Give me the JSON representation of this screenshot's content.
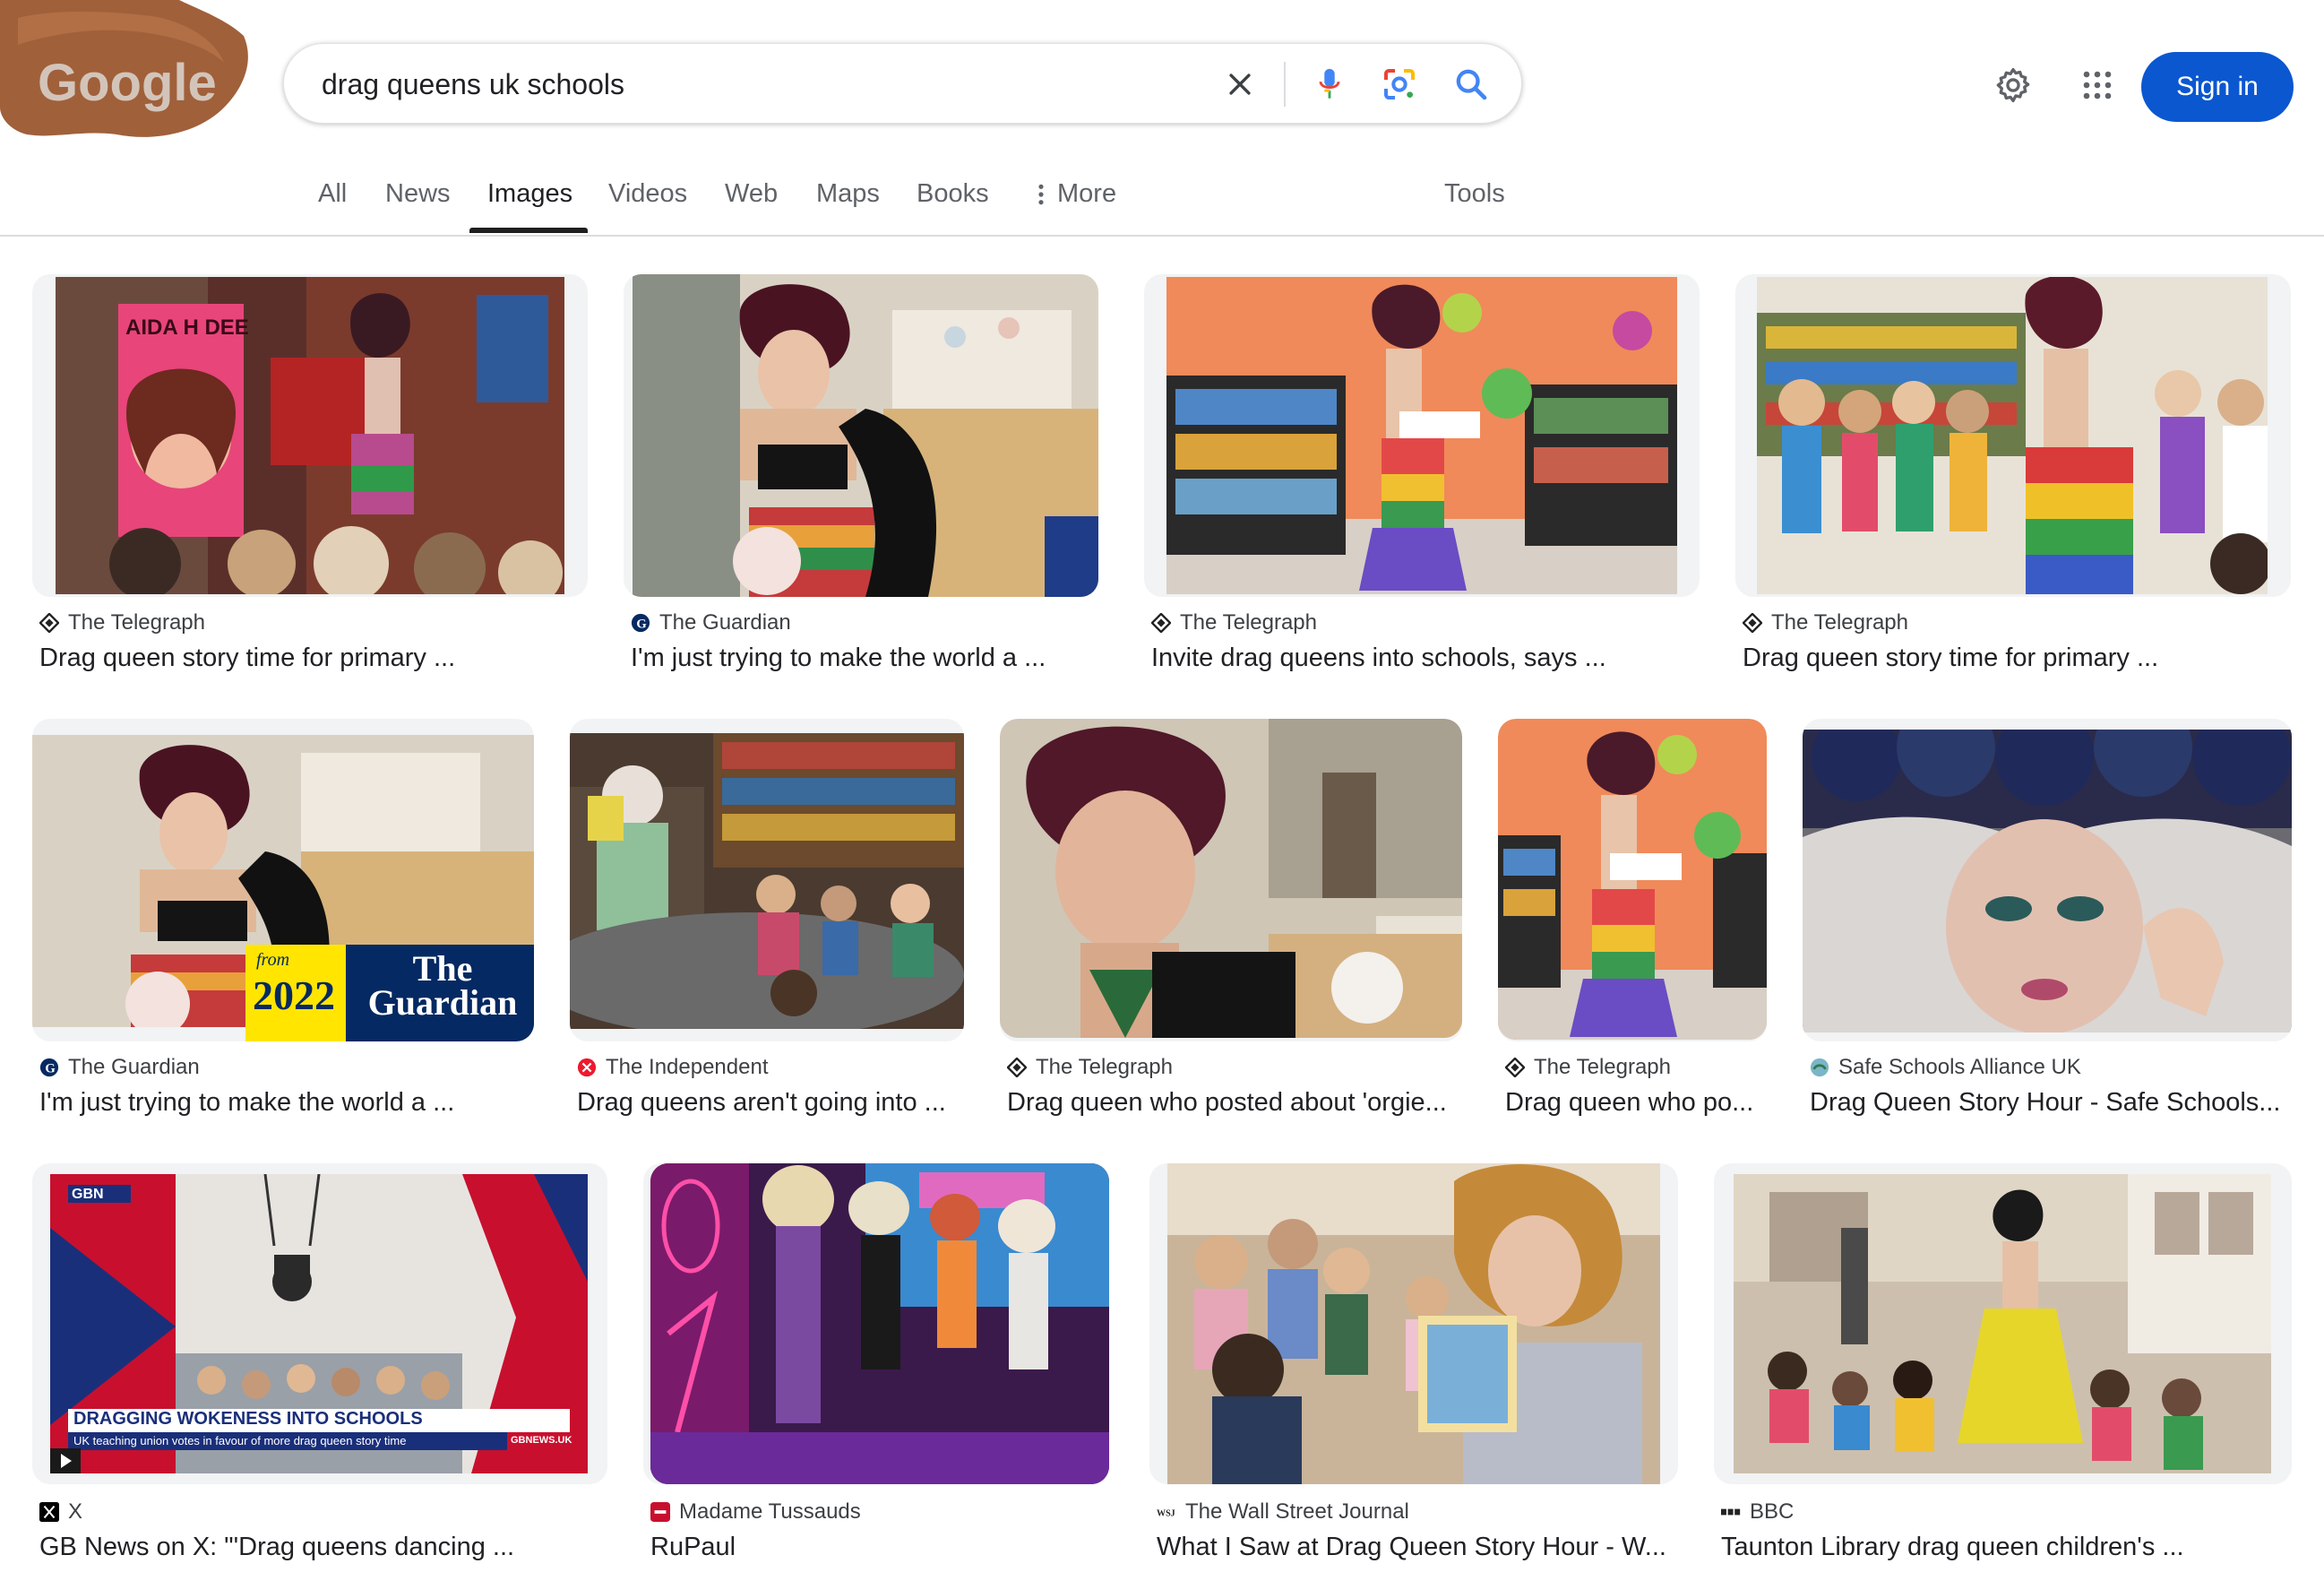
{
  "logo": {
    "text": "Google",
    "icon": "google-doodle-logo"
  },
  "search": {
    "query": "drag queens uk schools"
  },
  "header": {
    "signin_label": "Sign in"
  },
  "tabs": [
    {
      "label": "All"
    },
    {
      "label": "News"
    },
    {
      "label": "Images",
      "active": true
    },
    {
      "label": "Videos"
    },
    {
      "label": "Web"
    },
    {
      "label": "Maps"
    },
    {
      "label": "Books"
    },
    {
      "label": "More"
    },
    {
      "label": "Tools"
    }
  ],
  "results": [
    {
      "source": "The Telegraph",
      "title": "Drag queen story time for primary ...",
      "favicon": "telegraph-icon",
      "scene": "storytime stage with poster",
      "overlay": "AIDA H DEE"
    },
    {
      "source": "The Guardian",
      "title": "I'm just trying to make the world a ...",
      "favicon": "guardian-icon",
      "scene": "drag queen waving with child"
    },
    {
      "source": "The Telegraph",
      "title": "Invite drag queens into schools, says ...",
      "favicon": "telegraph-icon",
      "scene": "library orange wall"
    },
    {
      "source": "The Telegraph",
      "title": "Drag queen story time for primary ...",
      "favicon": "telegraph-icon",
      "scene": "children cheering in library"
    },
    {
      "source": "The Guardian",
      "title": "I'm just trying to make the world a ...",
      "favicon": "guardian-icon",
      "scene": "drag queen waving with child",
      "badge_from": "from",
      "badge_year": "2022",
      "badge_name": "The Guardian"
    },
    {
      "source": "The Independent",
      "title": "Drag queens aren't going into ...",
      "favicon": "independent-icon",
      "scene": "bookshop reading"
    },
    {
      "source": "The Telegraph",
      "title": "Drag queen who posted about 'orgie...",
      "favicon": "telegraph-icon",
      "scene": "portrait in cafe"
    },
    {
      "source": "The Telegraph",
      "title": "Drag queen who po...",
      "favicon": "telegraph-icon",
      "scene": "library orange wall"
    },
    {
      "source": "Safe Schools Alliance UK",
      "title": "Drag Queen Story Hour - Safe Schools...",
      "favicon": "safe-schools-icon",
      "scene": "close-up portrait"
    },
    {
      "source": "X",
      "title": "GB News on X: \"'Drag queens dancing ...",
      "favicon": "x-icon",
      "scene": "news broadcast",
      "overlay": "DRAGGING WOKENESS INTO SCHOOLS",
      "overlay_sub": "UK teaching union votes in favour of more drag queen story time",
      "overlay_channel": "GBN",
      "overlay_site": "GBNEWS.UK"
    },
    {
      "source": "Madame Tussauds",
      "title": "RuPaul",
      "favicon": "madame-tussauds-icon",
      "scene": "group of queens on purple stage"
    },
    {
      "source": "The Wall Street Journal",
      "title": "What I Saw at Drag Queen Story Hour - W...",
      "favicon": "wsj-icon",
      "scene": "reading to children"
    },
    {
      "source": "BBC",
      "title": "Taunton Library drag queen children's ...",
      "favicon": "bbc-icon",
      "scene": "library dance"
    }
  ],
  "colors": {
    "accent": "#0b57d0",
    "tab_active": "#1f1f1f",
    "text": "#202124",
    "muted": "#5f6368"
  }
}
